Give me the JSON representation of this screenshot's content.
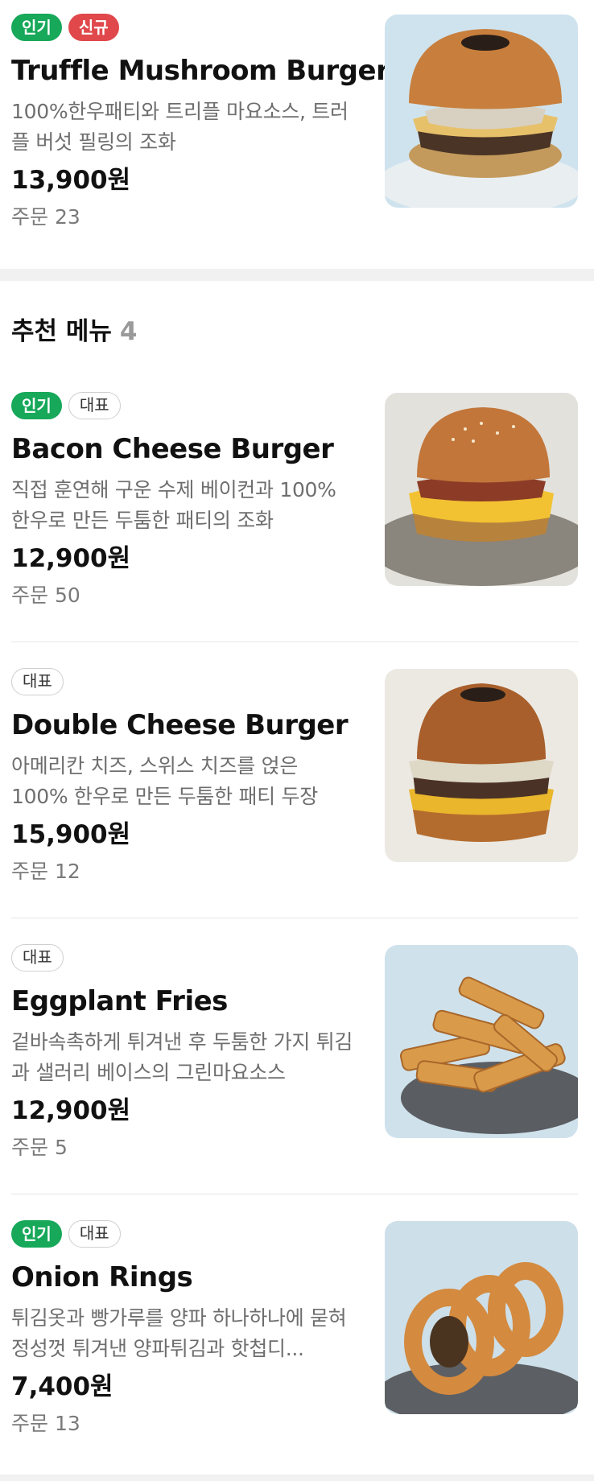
{
  "featured_item": {
    "badges": [
      "인기",
      "신규"
    ],
    "name": "Truffle Mushroom Burger",
    "description": "100%한우패티와 트리플 마요소스, 트러플 버섯 필링의 조화",
    "price": "13,900원",
    "orders": "주문 23",
    "image_icon": "burger-photo"
  },
  "recommended": {
    "title": "추천 메뉴",
    "count": "4",
    "items": [
      {
        "badges": [
          "인기",
          "대표"
        ],
        "name": "Bacon Cheese Burger",
        "description": "직접 훈연해 구운 수제 베이컨과 100% 한우로 만든 두툼한 패티의 조화",
        "price": "12,900원",
        "orders": "주문 50",
        "image_icon": "burger-photo"
      },
      {
        "badges": [
          "대표"
        ],
        "name": "Double Cheese Burger",
        "description": "아메리칸 치즈, 스위스 치즈를 얹은 100% 한우로 만든 두툼한 패티 두장",
        "price": "15,900원",
        "orders": "주문 12",
        "image_icon": "burger-photo"
      },
      {
        "badges": [
          "대표"
        ],
        "name": "Eggplant Fries",
        "description": "겉바속촉하게 튀겨낸 후 두툼한 가지 튀김과 샐러리 베이스의 그린마요소스",
        "price": "12,900원",
        "orders": "주문 5",
        "image_icon": "fries-photo"
      },
      {
        "badges": [
          "인기",
          "대표"
        ],
        "name": "Onion Rings",
        "description": "튀김옷과 빵가루를 양파 하나하나에 묻혀 정성껏 튀겨낸 양파튀김과 핫첩디...",
        "price": "7,400원",
        "orders": "주문 13",
        "image_icon": "onion-rings-photo"
      }
    ]
  },
  "colors": {
    "badge_popular": "#17a85a",
    "badge_new": "#e0484b",
    "badge_rep_border": "#cfcfcf",
    "section_gap": "#f1f1f1"
  }
}
